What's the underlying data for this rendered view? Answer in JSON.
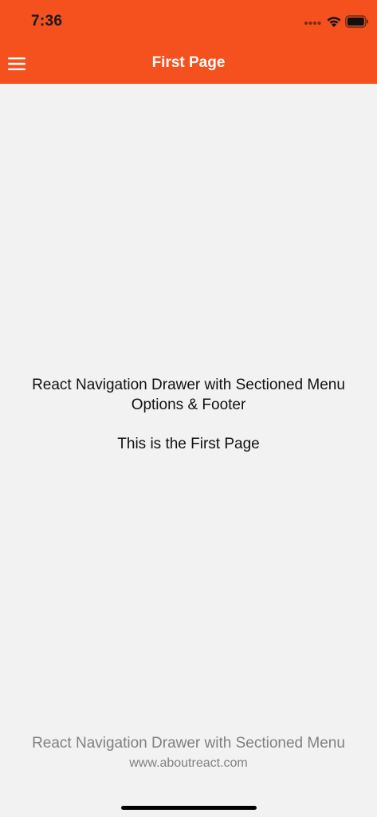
{
  "status_bar": {
    "time": "7:36",
    "icons": [
      "signal-icon",
      "wifi-icon",
      "battery-icon"
    ]
  },
  "nav_bar": {
    "title": "First Page",
    "menu_icon": "hamburger-menu-icon",
    "background_color": "#f4511e",
    "title_color": "#ffffff"
  },
  "content": {
    "heading": "React Navigation Drawer with Sectioned Menu Options & Footer",
    "subtitle": "This is the First Page"
  },
  "footer": {
    "title": "React Navigation Drawer with Sectioned Menu",
    "link": "www.aboutreact.com"
  },
  "colors": {
    "background": "#f2f2f2",
    "footer_text": "#808080"
  }
}
